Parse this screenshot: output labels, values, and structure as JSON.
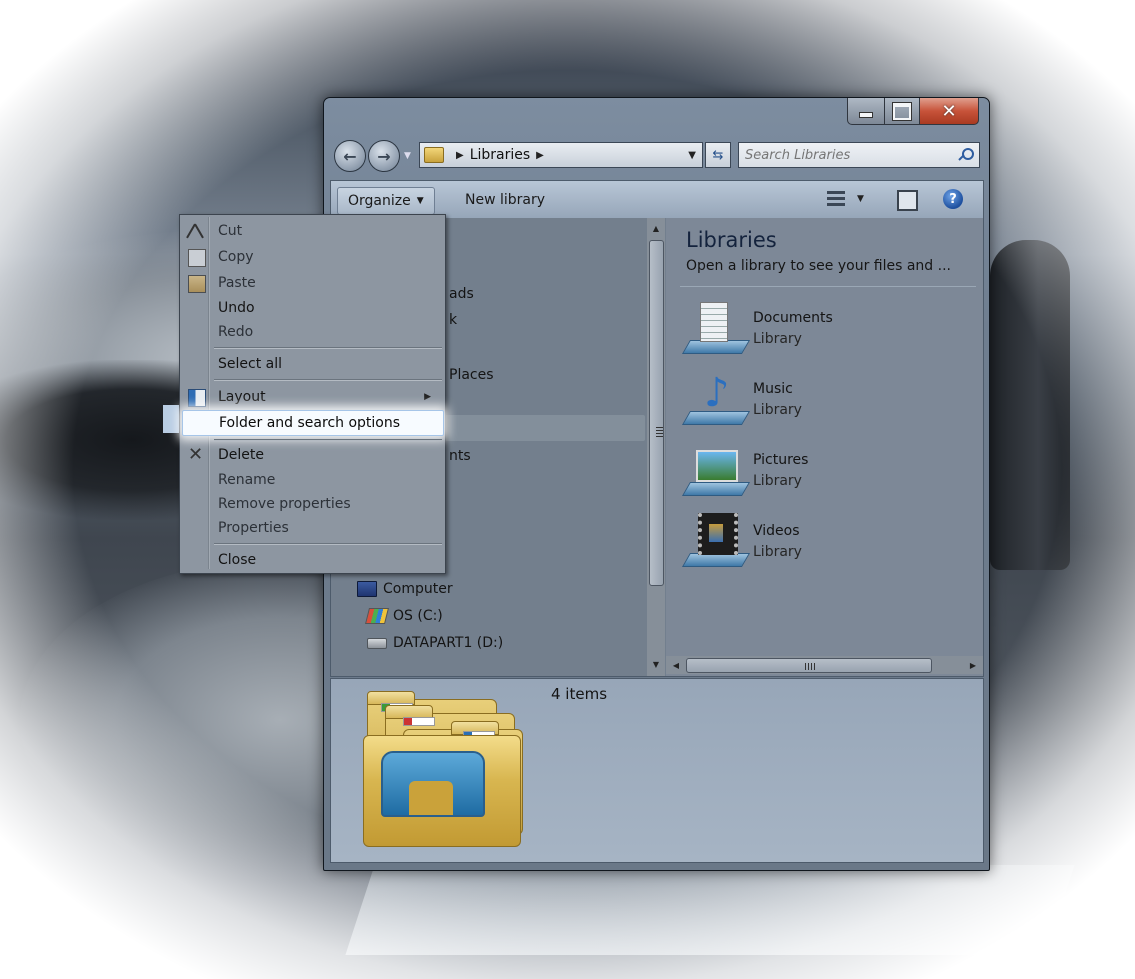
{
  "window": {
    "controls": {
      "minimize": "minimize",
      "maximize": "maximize",
      "close": "close"
    }
  },
  "address_bar": {
    "crumb": "Libraries",
    "separator": "▶"
  },
  "search": {
    "placeholder": "Search Libraries"
  },
  "toolbar": {
    "organize_label": "Organize",
    "new_library_label": "New library"
  },
  "nav_pane": {
    "fragments": [
      "ads",
      "k",
      "Places",
      "nts"
    ],
    "items": [
      {
        "label": "Computer",
        "icon": "computer-icon"
      },
      {
        "label": "OS (C:)",
        "icon": "windows-drive-icon"
      },
      {
        "label": "DATAPART1 (D:)",
        "icon": "drive-icon"
      }
    ]
  },
  "libraries": {
    "title": "Libraries",
    "subtitle": "Open a library to see your files and ...",
    "items": [
      {
        "name": "Documents",
        "type": "Library",
        "icon": "documents-library-icon"
      },
      {
        "name": "Music",
        "type": "Library",
        "icon": "music-library-icon"
      },
      {
        "name": "Pictures",
        "type": "Library",
        "icon": "pictures-library-icon"
      },
      {
        "name": "Videos",
        "type": "Library",
        "icon": "videos-library-icon"
      }
    ]
  },
  "details": {
    "count": "4 items"
  },
  "context_menu": {
    "items": [
      {
        "label": "Cut",
        "enabled": false,
        "icon": "scissors-icon"
      },
      {
        "label": "Copy",
        "enabled": false,
        "icon": "copy-icon"
      },
      {
        "label": "Paste",
        "enabled": false,
        "icon": "paste-icon"
      },
      {
        "label": "Undo",
        "enabled": true
      },
      {
        "label": "Redo",
        "enabled": false
      },
      {
        "label": "Select all",
        "enabled": true
      },
      {
        "label": "Layout",
        "enabled": true,
        "icon": "layout-icon",
        "submenu": true
      },
      {
        "label": "Folder and search options",
        "enabled": true,
        "highlighted": true
      },
      {
        "label": "Delete",
        "enabled": true,
        "icon": "delete-icon"
      },
      {
        "label": "Rename",
        "enabled": false
      },
      {
        "label": "Remove properties",
        "enabled": false
      },
      {
        "label": "Properties",
        "enabled": false
      },
      {
        "label": "Close",
        "enabled": true
      }
    ]
  },
  "colors": {
    "highlight": "#f7fbff",
    "close_button": "#c7533a",
    "accent_blue": "#2f5da0"
  }
}
